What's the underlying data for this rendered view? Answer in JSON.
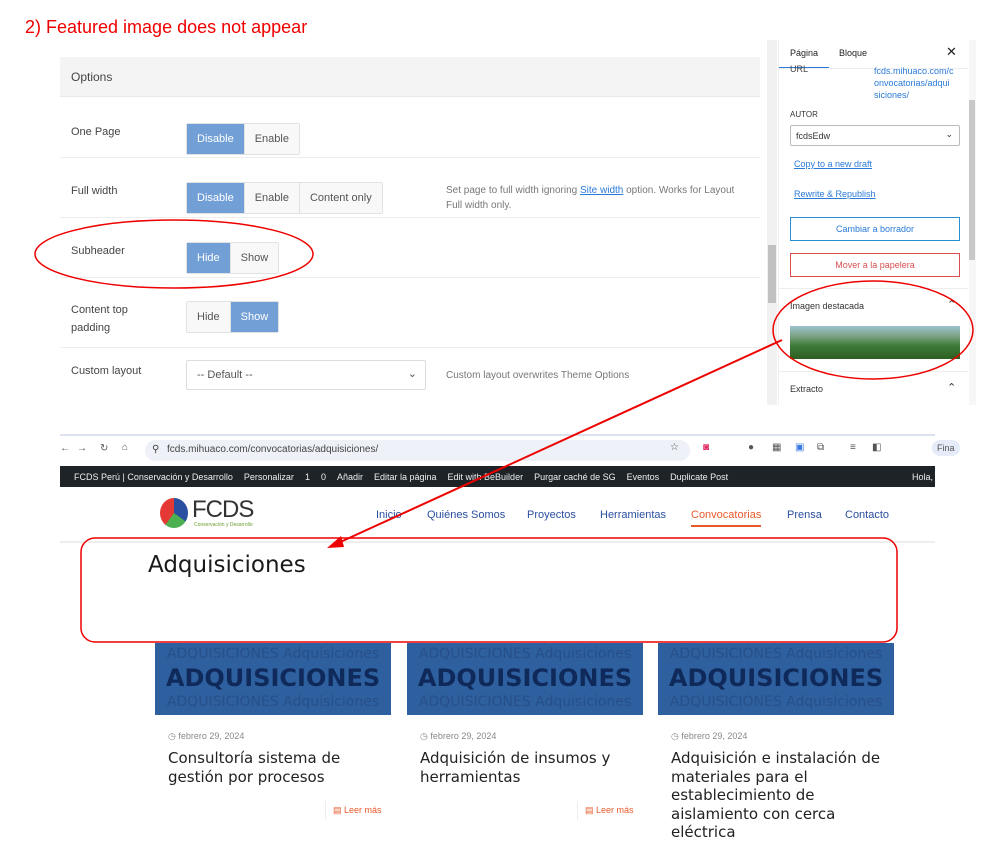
{
  "annotation_title": "2)  Featured image does not appear",
  "options": {
    "header": "Options",
    "rows": [
      {
        "label": "One Page",
        "buttons": [
          "Disable",
          "Enable"
        ],
        "active": 0
      },
      {
        "label": "Full width",
        "buttons": [
          "Disable",
          "Enable",
          "Content only"
        ],
        "active": 0,
        "help_pre": "Set page to full width ignoring ",
        "help_link": "Site width",
        "help_post": " option. Works for Layout Full width only."
      },
      {
        "label": "Subheader",
        "buttons": [
          "Hide",
          "Show"
        ],
        "active": 0
      },
      {
        "label": "Content top padding",
        "buttons": [
          "Hide",
          "Show"
        ],
        "active": 1
      },
      {
        "label": "Custom layout",
        "select": "-- Default --",
        "help": "Custom layout overwrites Theme Options"
      }
    ]
  },
  "sidebar": {
    "tabs": [
      "Página",
      "Bloque"
    ],
    "url_label": "URL",
    "url_value": "fcds.mihuaco.com/convocatorias/adquisiciones/",
    "author_label": "AUTOR",
    "author_value": "fcdsEdw",
    "copy_draft": "Copy to a new draft",
    "rewrite": "Rewrite & Republish",
    "switch_draft": "Cambiar a borrador",
    "trash": "Mover a la papelera",
    "featured_image": "Imagen destacada",
    "excerpt": "Extracto"
  },
  "browser": {
    "url": "fcds.mihuaco.com/convocatorias/adquisiciones/",
    "profile": "Fina"
  },
  "admin_bar": [
    "FCDS Perú | Conservación y Desarrollo",
    "Personalizar",
    "1",
    "0",
    "Añadir",
    "Editar la página",
    "Edit with BeBuilder",
    "Purgar caché de SG",
    "Eventos",
    "Duplicate Post"
  ],
  "admin_greeting": "Hola,",
  "site": {
    "logo": "FCDS",
    "logo_sub": "Conservación y Desarrollo",
    "nav": [
      "Inicio",
      "Quiénes Somos",
      "Proyectos",
      "Herramientas",
      "Convocatorias",
      "Prensa",
      "Contacto"
    ],
    "active_nav": 4,
    "page_title": "Adquisiciones"
  },
  "cards": [
    {
      "img_small": "ADQUISICIONES Adquisiciones",
      "img_big": "ADQUISICIONES",
      "date": "febrero 29, 2024",
      "title": "Consultoría sistema de gestión por procesos",
      "more": "Leer más"
    },
    {
      "img_small": "ADQUISICIONES Adquisiciones",
      "img_big": "ADQUISICIONES",
      "date": "febrero 29, 2024",
      "title": "Adquisición de insumos y herramientas",
      "more": "Leer más"
    },
    {
      "img_small": "ADQUISICIONES Adquisiciones",
      "img_big": "ADQUISICIONES",
      "date": "febrero 29, 2024",
      "title": "Adquisición e instalación de materiales para el establecimiento de aislamiento con cerca eléctrica"
    }
  ],
  "colors": {
    "annotation": "#ee0000",
    "active_button": "#72a0d6",
    "accent": "#e95a2b",
    "nav": "#2a4fa0",
    "card_image": "#2e5f9e"
  }
}
